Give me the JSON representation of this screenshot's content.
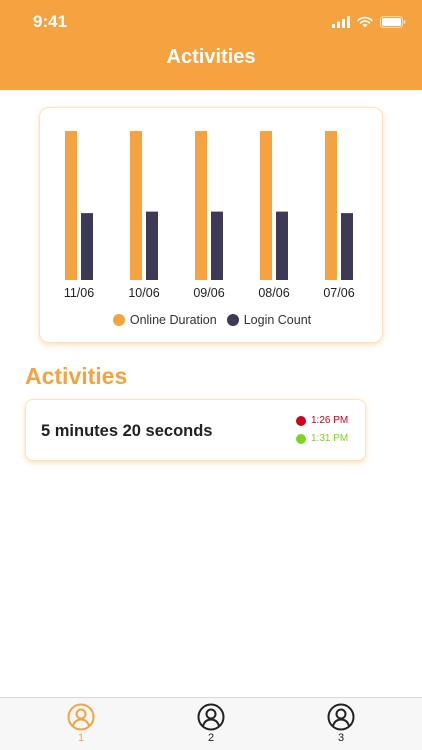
{
  "status_bar": {
    "time": "9:41"
  },
  "header": {
    "title": "Activities"
  },
  "chart_data": {
    "type": "bar",
    "categories": [
      "11/06",
      "10/06",
      "09/06",
      "08/06",
      "07/06"
    ],
    "series": [
      {
        "name": "Online Duration",
        "color": "#f5a340",
        "values": [
          98,
          98,
          98,
          98,
          98
        ]
      },
      {
        "name": "Login Count",
        "color": "#3c3a55",
        "values": [
          44,
          45,
          45,
          45,
          44
        ]
      }
    ]
  },
  "activities_section": {
    "title": "Activities",
    "items": [
      {
        "duration": "5 minutes 20 seconds",
        "start": "1:26 PM",
        "start_color": "#d0021b",
        "end": "1:31 PM",
        "end_color": "#7ed321"
      }
    ]
  },
  "tabbar": {
    "active_color": "#f5a340",
    "inactive_color": "#222222",
    "tabs": [
      {
        "label": "1",
        "icon": "user-icon"
      },
      {
        "label": "2",
        "icon": "user-icon"
      },
      {
        "label": "3",
        "icon": "user-icon"
      }
    ]
  }
}
